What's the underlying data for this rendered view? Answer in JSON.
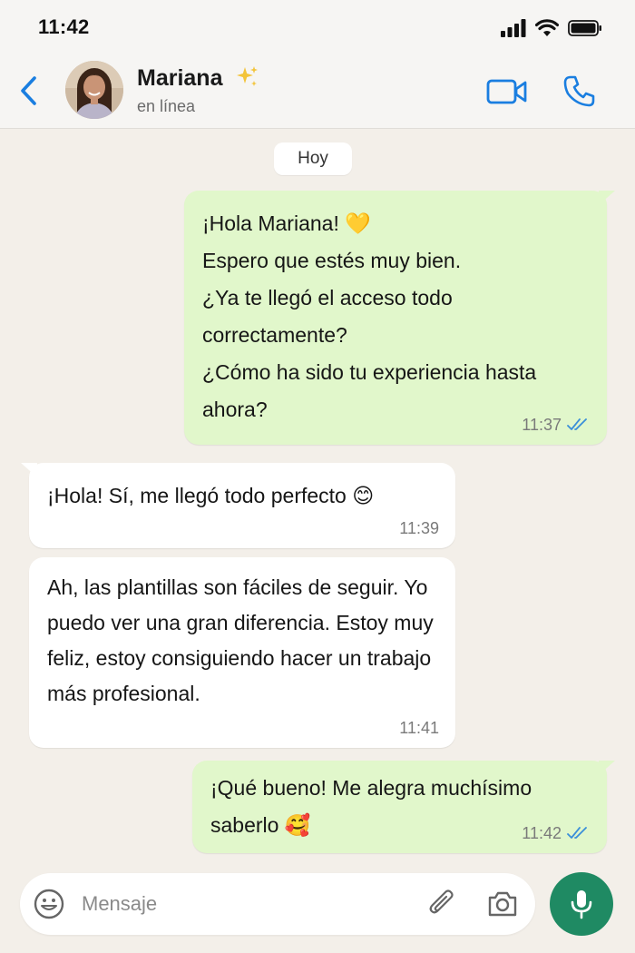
{
  "status_bar": {
    "time": "11:42"
  },
  "header": {
    "contact_name": "Mariana",
    "contact_status": "en línea",
    "icons": [
      "back-icon",
      "sparkle-icon",
      "video-call-icon",
      "phone-icon"
    ]
  },
  "chat": {
    "date_label": "Hoy",
    "messages": [
      {
        "direction": "out",
        "text": "¡Hola Mariana! 💛\nEspero que estés muy bien.\n¿Ya te llegó el acceso todo correctamente?\n¿Cómo ha sido tu experiencia hasta ahora?",
        "time": "11:37",
        "status": "read"
      },
      {
        "direction": "in",
        "text": "¡Hola! Sí, me llegó todo perfecto 😊",
        "time": "11:39"
      },
      {
        "direction": "in",
        "text": "Ah, las plantillas son fáciles de seguir. Yo puedo ver una gran diferencia. Estoy muy feliz, estoy consiguiendo hacer un trabajo más profesional.",
        "time": "11:41"
      },
      {
        "direction": "out",
        "text": "¡Qué bueno! Me alegra muchísimo saberlo 🥰",
        "time": "11:42",
        "status": "read"
      }
    ]
  },
  "input_bar": {
    "placeholder": "Mensaje",
    "icons": [
      "emoji-icon",
      "attach-icon",
      "camera-icon",
      "mic-icon"
    ]
  },
  "colors": {
    "accent": "#1a7ee0",
    "outgoing_bubble": "#e1f7cb",
    "incoming_bubble": "#ffffff",
    "mic_button": "#1f8a63",
    "read_ticks": "#3a8fd9"
  }
}
